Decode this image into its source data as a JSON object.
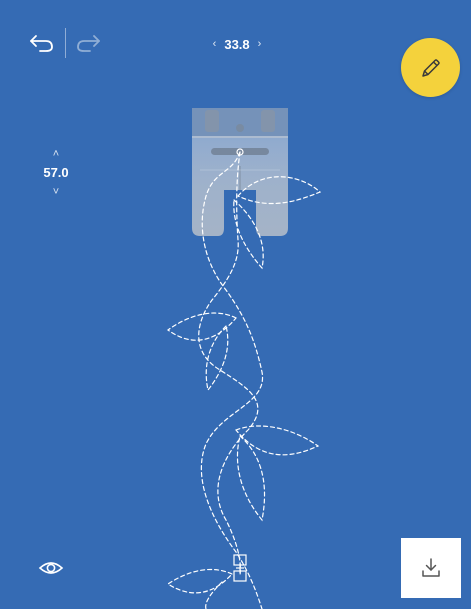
{
  "toolbar": {
    "undo_icon": "undo-icon",
    "redo_icon": "redo-icon",
    "edit_icon": "pencil-icon"
  },
  "stitch_length": {
    "value": "33.8",
    "decrease": "‹",
    "increase": "›"
  },
  "stitch_width": {
    "value": "57.0",
    "increase": "˄",
    "decrease": "˅"
  },
  "canvas": {
    "presser_foot": "presser-foot-graphic",
    "pattern": "leaf-vine-stitch-pattern",
    "stitch_color": "#ffffff"
  },
  "bottom": {
    "view_icon": "eye-icon",
    "download_icon": "download-icon"
  },
  "colors": {
    "background": "#356bb4",
    "accent": "#f4d23c"
  }
}
